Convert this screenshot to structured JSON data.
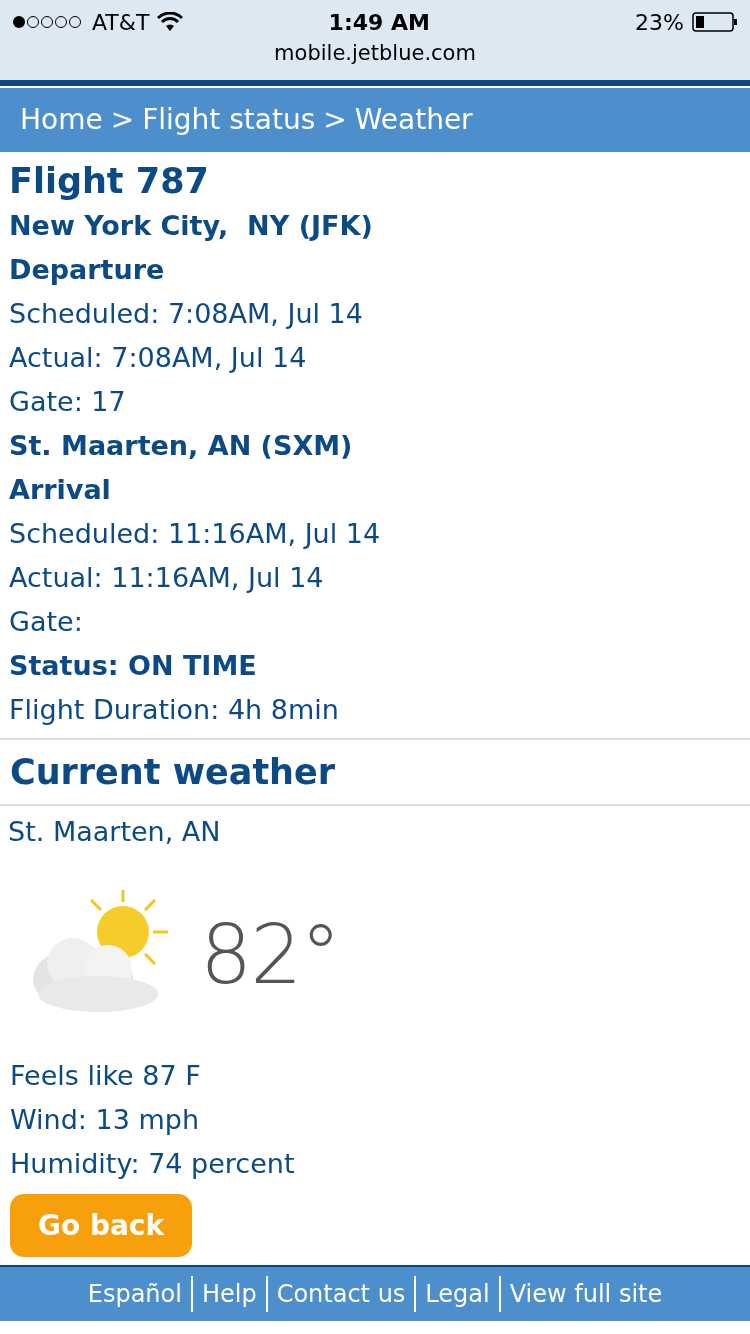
{
  "status_bar": {
    "carrier": "AT&T",
    "time": "1:49 AM",
    "battery": "23%"
  },
  "address_bar": {
    "url": "mobile.jetblue.com"
  },
  "breadcrumb": [
    "Home",
    ">",
    "Flight status",
    ">",
    "Weather"
  ],
  "flight": {
    "title": "Flight 787",
    "lines": [
      {
        "kind": "bold",
        "text": "New York City,  NY (JFK)"
      },
      {
        "kind": "bold",
        "text": "Departure"
      },
      {
        "kind": "plain",
        "text": "Scheduled: 7:08AM, Jul 14"
      },
      {
        "kind": "plain",
        "text": "Actual: 7:08AM, Jul 14"
      },
      {
        "kind": "plain",
        "text": "Gate: 17"
      },
      {
        "kind": "bold",
        "text": "St. Maarten, AN (SXM)"
      },
      {
        "kind": "bold",
        "text": "Arrival"
      },
      {
        "kind": "plain",
        "text": "Scheduled: 11:16AM, Jul 14"
      },
      {
        "kind": "plain",
        "text": "Actual: 11:16AM, Jul 14"
      },
      {
        "kind": "plain",
        "text": "Gate:"
      },
      {
        "kind": "bold",
        "text": "Status: ON TIME"
      },
      {
        "kind": "plain",
        "text": "Flight Duration: 4h 8min"
      }
    ]
  },
  "weather": {
    "title": "Current weather",
    "location": "St. Maarten, AN",
    "temperature": "82°",
    "details": [
      "Feels like 87 F",
      "Wind: 13 mph",
      "Humidity: 74 percent"
    ]
  },
  "back_button": "Go back",
  "footer_links": [
    "Español",
    "Help",
    "Contact us",
    "Legal",
    "View full site"
  ]
}
